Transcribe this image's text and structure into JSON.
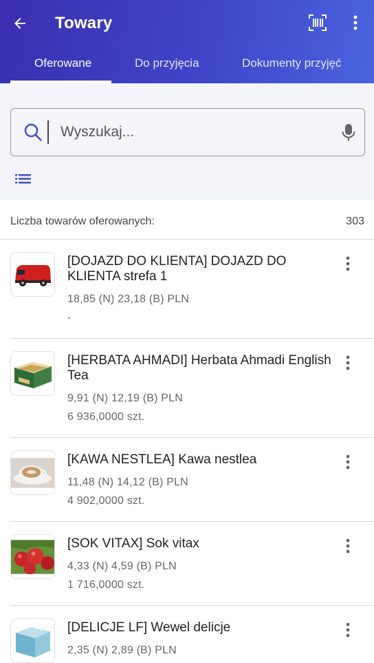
{
  "appbar": {
    "title": "Towary",
    "back_icon": "arrow-left-icon",
    "barcode_icon": "barcode-scan-icon",
    "more_icon": "more-vertical-icon",
    "colors": {
      "gradient_start": "#3a2fb0",
      "gradient_end": "#4a63de"
    }
  },
  "tabs": [
    {
      "label": "Oferowane",
      "active": true
    },
    {
      "label": "Do przyjęcia",
      "active": false
    },
    {
      "label": "Dokumenty przyjęć",
      "active": false
    }
  ],
  "search": {
    "placeholder": "Wyszukaj...",
    "value": ""
  },
  "summary": {
    "label": "Liczba towarów oferowanych:",
    "count": "303"
  },
  "items": [
    {
      "name": "[DOJAZD DO KLIENTA] DOJAZD DO KLIENTA strefa 1",
      "price": "18,85 (N)  23,18 (B) PLN",
      "qty": "-",
      "thumb": "red-van-image"
    },
    {
      "name": "[HERBATA AHMADI] Herbata Ahmadi English Tea",
      "price": "9,91 (N)  12,19 (B) PLN",
      "qty": "6 936,0000 szt.",
      "thumb": "tea-box-image"
    },
    {
      "name": "[KAWA NESTLEA] Kawa nestlea",
      "price": "11,48 (N)  14,12 (B) PLN",
      "qty": "4 902,0000 szt.",
      "thumb": "coffee-cup-image"
    },
    {
      "name": "[SOK VITAX] Sok vitax",
      "price": "4,33 (N)  4,59 (B) PLN",
      "qty": "1 716,0000 szt.",
      "thumb": "apples-image"
    },
    {
      "name": "[DELICJE LF] Wewel delicje",
      "price": "2,35 (N)  2,89 (B) PLN",
      "qty": "",
      "thumb": "cardboard-box-image"
    }
  ]
}
